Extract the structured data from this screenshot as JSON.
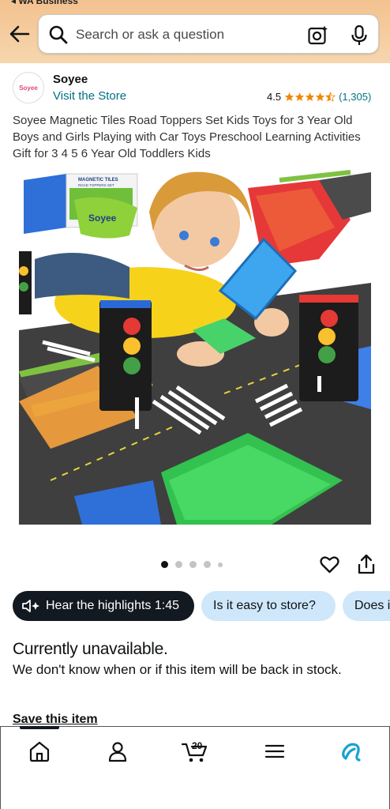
{
  "status_bar": {
    "back_app": "◂ WA Business"
  },
  "header": {
    "search_placeholder": "Search or ask a question",
    "colors": {
      "gradient_top": "#f3c28f",
      "gradient_bottom": "#f6d6ae"
    }
  },
  "seller": {
    "logo_text": "Soyee",
    "name": "Soyee",
    "visit_store": "Visit the Store",
    "rating_value": "4.5",
    "rating_stars": 4.5,
    "rating_count": "(1,305)"
  },
  "product": {
    "title": "Soyee Magnetic Tiles Road Toppers Set Kids Toys for 3 Year Old Boys and Girls Playing with Car Toys Preschool Learning Activities Gift for 3 4 5 6 Year Old Toddlers Kids",
    "image_box_title": "MAGNETIC TILES",
    "image_box_subtitle": "ROAD TOPPERS SET",
    "image_bag_label": "Soyee",
    "image_count": 5,
    "active_image_index": 0
  },
  "chips": {
    "highlights": "Hear the highlights 1:45",
    "q1": "Is it easy to store?",
    "q2": "Does i"
  },
  "availability": {
    "title": "Currently unavailable.",
    "message": "We don't know when or if this item will be back in stock.",
    "save_label": "Save this item"
  },
  "bottom_nav": {
    "cart_count": "20",
    "icons": [
      "home-icon",
      "account-icon",
      "cart-icon",
      "menu-icon",
      "rufus-icon"
    ]
  },
  "colors": {
    "link": "#007185",
    "star": "#f08804",
    "chip_dark": "#131921",
    "chip_light": "#cfe7fb",
    "rufus": "#1aa2d3"
  }
}
